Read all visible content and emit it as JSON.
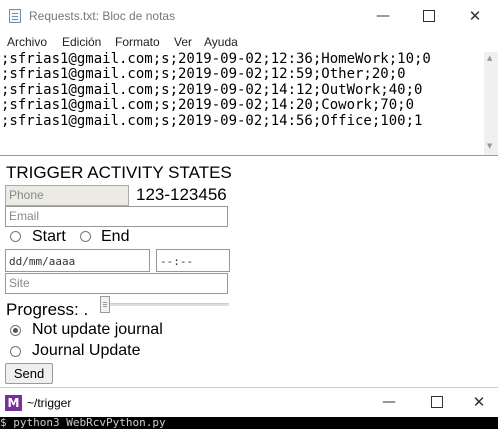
{
  "notepad": {
    "title": "Requests.txt: Bloc de notas",
    "window_controls": {
      "minimize": "—",
      "close": "✕"
    },
    "menu": [
      "Archivo",
      "Edición",
      "Formato",
      "Ver",
      "Ayuda"
    ],
    "content": ";sfrias1@gmail.com;s;2019-09-02;12:36;HomeWork;10;0\n;sfrias1@gmail.com;s;2019-09-02;12:59;Other;20;0\n;sfrias1@gmail.com;s;2019-09-02;14:12;OutWork;40;0\n;sfrias1@gmail.com;s;2019-09-02;14:20;Cowork;70;0\n;sfrias1@gmail.com;s;2019-09-02;14:56;Office;100;1"
  },
  "form": {
    "title": "TRIGGER ACTIVITY STATES",
    "phone": {
      "placeholder": "Phone",
      "value_text": "123-123456"
    },
    "email": {
      "placeholder": "Email"
    },
    "state_options": [
      {
        "label": "Start",
        "checked": false
      },
      {
        "label": "End",
        "checked": false
      }
    ],
    "date": {
      "value": "dd/mm/aaaa"
    },
    "time": {
      "value": "--:--"
    },
    "site": {
      "placeholder": "Site"
    },
    "progress": {
      "label": "Progress: .",
      "value_fraction": 0.0
    },
    "journal_options": [
      {
        "label": "Not update journal",
        "checked": true
      },
      {
        "label": "Journal Update",
        "checked": false
      }
    ],
    "send_label": "Send"
  },
  "terminal": {
    "icon_letter": "M",
    "title": "~/trigger",
    "window_controls": {
      "minimize": "—",
      "close": "✕"
    },
    "command_line": "$ python3 WebRcvPython.py"
  }
}
